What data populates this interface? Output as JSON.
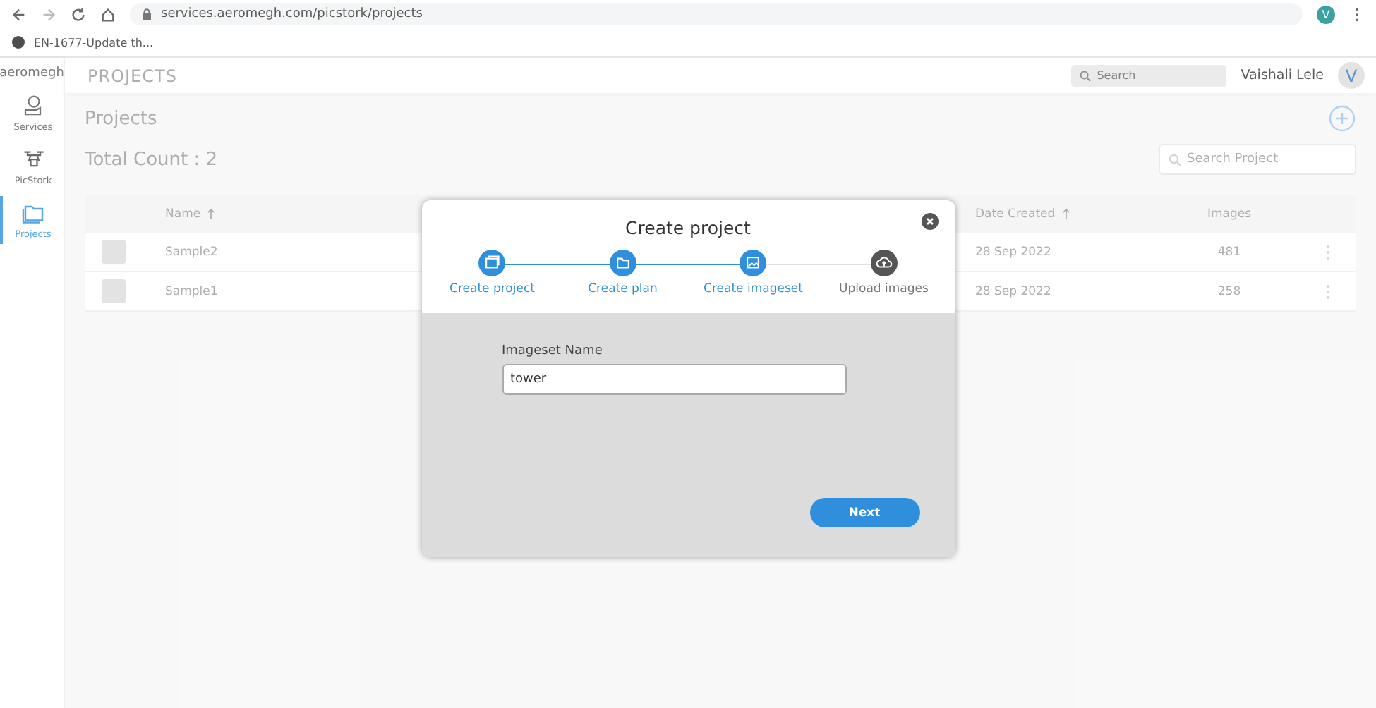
{
  "browser": {
    "url": "services.aeromegh.com/picstork/projects",
    "bookmark": "EN-1677-Update th...",
    "profile": "V"
  },
  "logo": "aeromegh",
  "sidebar": {
    "items": [
      {
        "label": "Services",
        "selected": false
      },
      {
        "label": "PicStork",
        "selected": false
      },
      {
        "label": "Projects",
        "selected": true
      }
    ]
  },
  "header": {
    "title": "PROJECTS",
    "search": {
      "placeholder": "Search"
    },
    "user": "Vaishali Lele",
    "avatar": "V"
  },
  "content": {
    "title": "Projects",
    "total": "Total Count : 2",
    "search": {
      "placeholder": "Search Project"
    },
    "table": {
      "columns": [
        {
          "label": "Name",
          "sorted": true
        },
        {
          "label": "Date Created",
          "sorted": true
        },
        {
          "label": "Images",
          "sorted": false
        }
      ],
      "rows": [
        {
          "name": "Sample2",
          "date": "28 Sep 2022",
          "images": "481"
        },
        {
          "name": "Sample1",
          "date": "28 Sep 2022",
          "images": "258"
        }
      ]
    }
  },
  "modal": {
    "title": "Create project",
    "steps": [
      {
        "label": "Create project",
        "completed": true
      },
      {
        "label": "Create plan",
        "completed": true
      },
      {
        "label": "Create imageset",
        "completed": true
      },
      {
        "label": "Upload images",
        "completed": false
      }
    ],
    "field": {
      "label": "Imageset Name",
      "value": "tower"
    },
    "button": "Next"
  }
}
